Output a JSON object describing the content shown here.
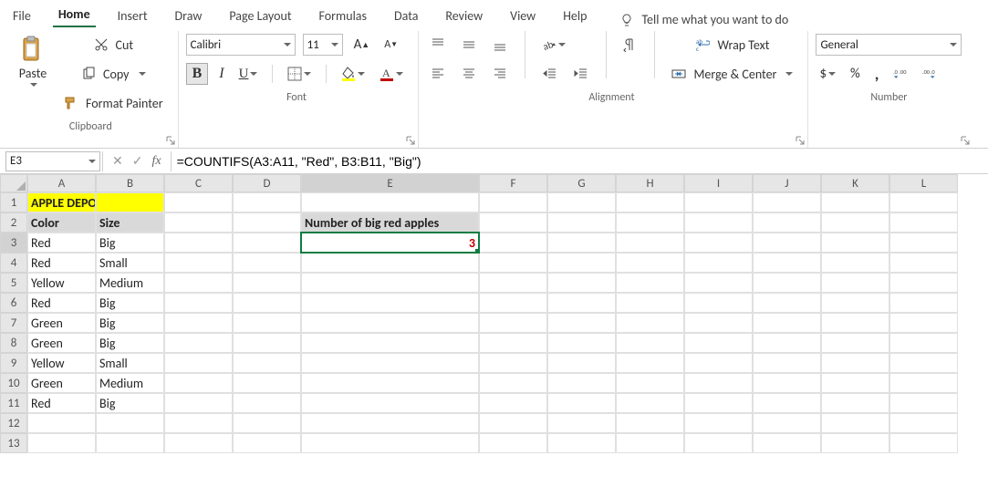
{
  "tabs": {
    "file": "File",
    "home": "Home",
    "insert": "Insert",
    "draw": "Draw",
    "pagelayout": "Page Layout",
    "formulas": "Formulas",
    "data": "Data",
    "review": "Review",
    "view": "View",
    "help": "Help",
    "tellme": "Tell me what you want to do",
    "active": "home"
  },
  "ribbon": {
    "clipboard": {
      "paste": "Paste",
      "cut": "Cut",
      "copy": "Copy",
      "painter": "Format Painter",
      "label": "Clipboard"
    },
    "font": {
      "name": "Calibri",
      "size": "11",
      "bold": "B",
      "italic": "I",
      "underline": "U",
      "label": "Font"
    },
    "alignment": {
      "wrap": "Wrap Text",
      "merge": "Merge & Center",
      "label": "Alignment"
    },
    "number": {
      "format": "General",
      "pct": "%",
      "comma": ",",
      "label": "Number"
    }
  },
  "fxbar": {
    "namebox": "E3",
    "fxlabel": "fx",
    "formula": "=COUNTIFS(A3:A11, \"Red\", B3:B11, \"Big\")"
  },
  "cols": [
    "A",
    "B",
    "C",
    "D",
    "E",
    "F",
    "G",
    "H",
    "I",
    "J",
    "K",
    "L"
  ],
  "rows": [
    "1",
    "2",
    "3",
    "4",
    "5",
    "6",
    "7",
    "8",
    "9",
    "10",
    "11",
    "12",
    "13"
  ],
  "sel": {
    "col": "E",
    "row": "3"
  },
  "cells": {
    "A1": "APPLE DEPOSIT",
    "A2": "Color",
    "B2": "Size",
    "A3": "Red",
    "B3": "Big",
    "A4": "Red",
    "B4": "Small",
    "A5": "Yellow",
    "B5": "Medium",
    "A6": "Red",
    "B6": "Big",
    "A7": "Green",
    "B7": "Big",
    "A8": "Green",
    "B8": "Big",
    "A9": "Yellow",
    "B9": "Small",
    "A10": "Green",
    "B10": "Medium",
    "A11": "Red",
    "B11": "Big",
    "E2": "Number of big red apples",
    "E3": "3"
  }
}
